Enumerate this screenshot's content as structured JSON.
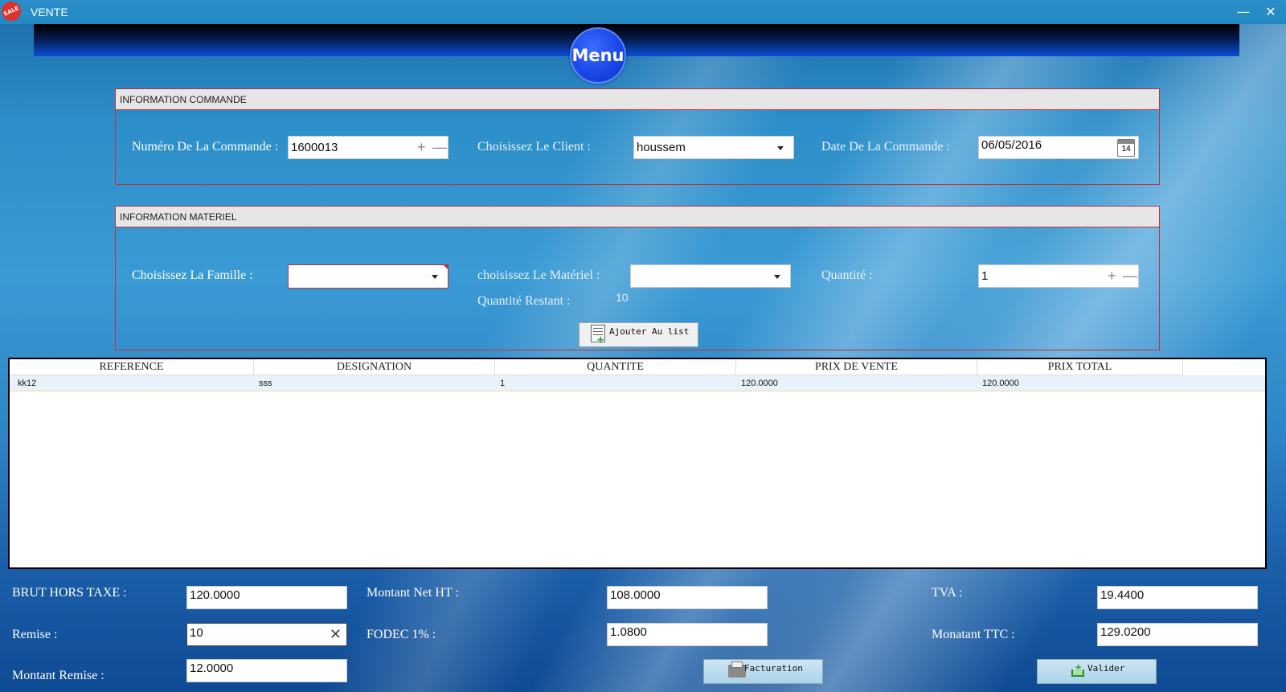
{
  "window": {
    "title": "VENTE",
    "icon_text": "SALE",
    "minimize_icon": "minimize-icon",
    "close_icon": "close-icon"
  },
  "menu": {
    "label": "Menu"
  },
  "commande": {
    "header": "INFORMATION COMMANDE",
    "numero_label": "Numéro De La Commande :",
    "numero_value": "1600013",
    "client_label": "Choisissez Le Client :",
    "client_value": "houssem",
    "date_label": "Date De La Commande :",
    "date_value": "06/05/2016",
    "calendar_day": "14"
  },
  "materiel": {
    "header": "INFORMATION MATERIEL",
    "famille_label": "Choisissez La Famille :",
    "famille_value": "",
    "materiel_label": "choisissez Le Matériel :",
    "materiel_value": "",
    "quantite_label": "Quantité :",
    "quantite_value": "1",
    "restant_label": "Quantité Restant :",
    "restant_value": "10",
    "add_button": "Ajouter Au list"
  },
  "grid": {
    "columns": [
      "REFERENCE",
      "DESIGNATION",
      "QUANTITE",
      "PRIX DE VENTE",
      "PRIX TOTAL"
    ],
    "rows": [
      [
        "kk12",
        "sss",
        "1",
        "120.0000",
        "120.0000"
      ]
    ]
  },
  "totals": {
    "brut_label": "BRUT HORS TAXE :",
    "brut_value": "120.0000",
    "remise_label": "Remise :",
    "remise_value": "10",
    "montant_remise_label": "Montant Remise :",
    "montant_remise_value": "12.0000",
    "net_label": "Montant Net HT :",
    "net_value": "108.0000",
    "fodec_label": "FODEC 1% :",
    "fodec_value": "1.0800",
    "tva_label": "TVA :",
    "tva_value": "19.4400",
    "ttc_label": "Monatant TTC :",
    "ttc_value": "129.0200",
    "facturation_button": "Facturation",
    "valider_button": "Valider"
  },
  "colors": {
    "group_border": "#c0303a",
    "menu_button": "#1a48e8"
  }
}
